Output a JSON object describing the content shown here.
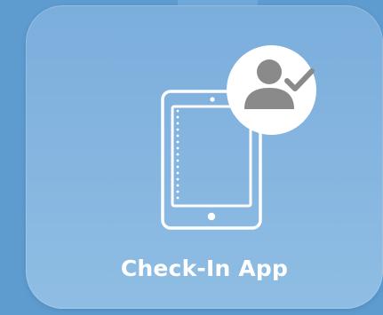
{
  "app_tile": {
    "label": "Check-In App",
    "icon": "tablet-icon",
    "badge_icon": "user-check-icon",
    "colors": {
      "background": "#5e9cd0",
      "tile": "#86b6e0",
      "icon_stroke": "#ffffff",
      "badge_fill": "#ffffff",
      "badge_glyph": "#8a8a8a",
      "label": "#ffffff"
    }
  }
}
